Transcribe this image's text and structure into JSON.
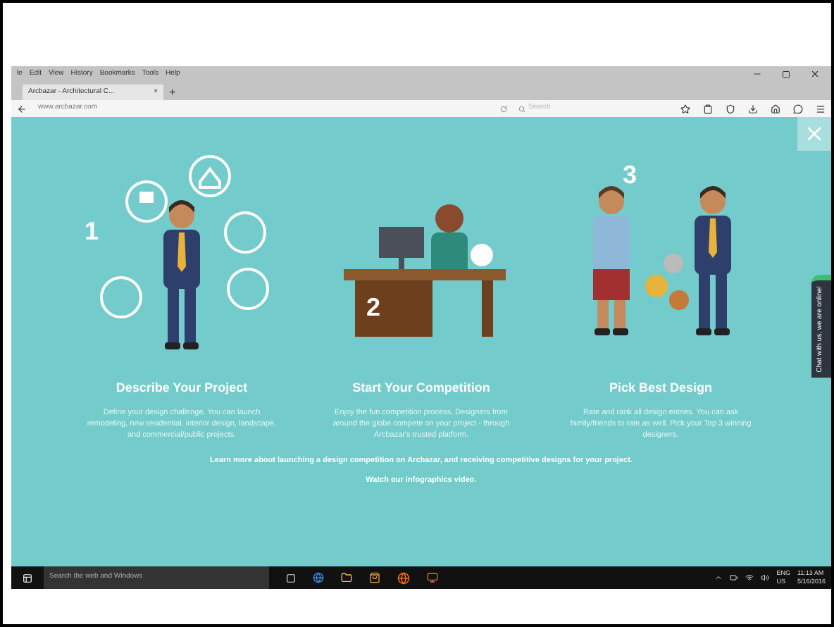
{
  "browser": {
    "menu": [
      "le",
      "Edit",
      "View",
      "History",
      "Bookmarks",
      "Tools",
      "Help"
    ],
    "tab": {
      "title": "Arcbazar - Architectural C...",
      "close": "×",
      "new_tab": "+"
    },
    "url": "www.arcbazar.com",
    "search": {
      "placeholder": "Search"
    }
  },
  "page": {
    "steps": [
      {
        "number": "1",
        "kind": "describe",
        "title": "Describe Your Project",
        "text": "Define your design challenge. You can launch remodeling, new residential, interior design, landscape, and commercial/public projects."
      },
      {
        "number": "2",
        "kind": "compete",
        "title": "Start Your Competition",
        "text": "Enjoy the fun competition process. Designers from around the globe compete on your project - through Arcbazar's trusted platform."
      },
      {
        "number": "3",
        "kind": "pick",
        "title": "Pick Best Design",
        "text": "Rate and rank all design entries. You can ask family/friends to rate as well. Pick your Top 3 winning designers."
      }
    ],
    "learn_more": "Learn more about launching a design competition on Arcbazar, and receiving competitive designs for your project.",
    "video_link": "Watch our infographics video.",
    "chat": "Chat with us, we are online!"
  },
  "taskbar": {
    "search": "Search the web and Windows",
    "language": "ENG",
    "region": "US",
    "time": "11:13 AM",
    "date": "5/16/2016"
  }
}
